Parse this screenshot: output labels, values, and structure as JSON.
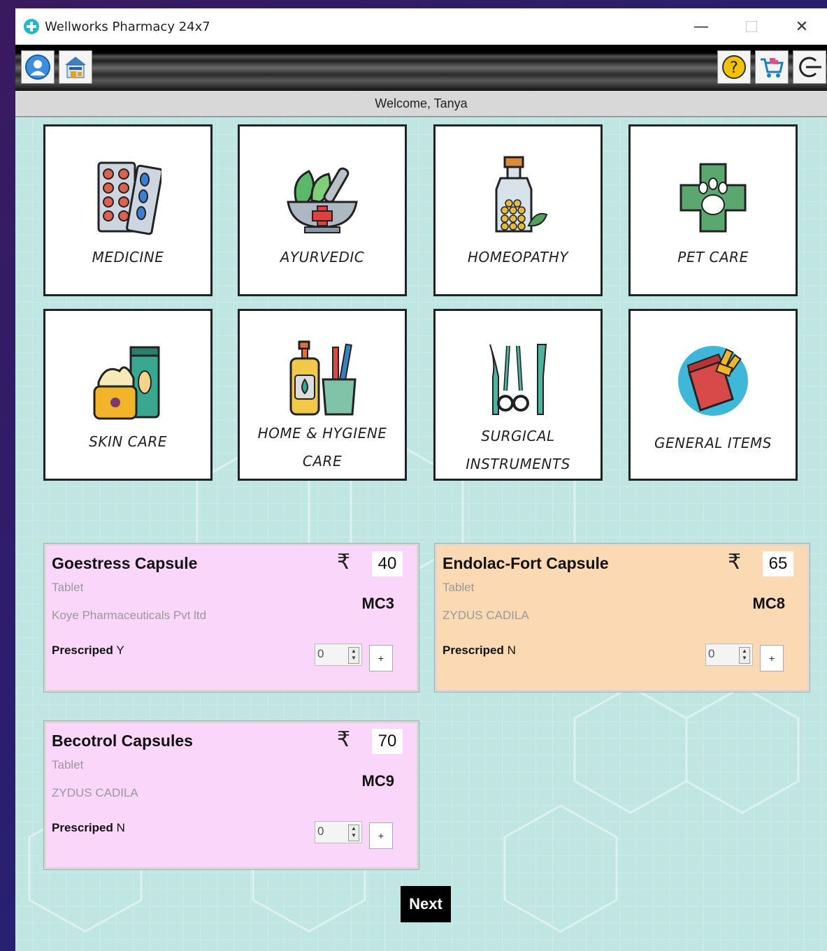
{
  "window": {
    "title": "Wellworks Pharmacy 24x7",
    "controls": {
      "minimize": "—",
      "close": "✕"
    }
  },
  "toolbar": {
    "left_icons": [
      "user-profile-icon",
      "store-icon"
    ],
    "right_icons": [
      "help-icon",
      "cart-icon",
      "logout-icon"
    ],
    "help_glyph": "?"
  },
  "welcome": {
    "text": "Welcome, Tanya"
  },
  "categories": [
    {
      "label": "MEDICINE",
      "icon": "medicine-blister-icon"
    },
    {
      "label": "AYURVEDIC",
      "icon": "mortar-pestle-icon"
    },
    {
      "label": "HOMEOPATHY",
      "icon": "homeopathy-bottle-icon"
    },
    {
      "label": "PET CARE",
      "icon": "pet-care-cross-icon"
    },
    {
      "label": "SKIN CARE",
      "icon": "skin-care-cream-icon"
    },
    {
      "label_line1": "HOME & HYGIENE",
      "label_line2": "CARE",
      "icon": "soap-toothbrush-icon"
    },
    {
      "label_line1": "SURGICAL",
      "label_line2": "INSTRUMENTS",
      "icon": "surgical-tools-icon"
    },
    {
      "label": "GENERAL ITEMS",
      "icon": "general-items-bag-icon"
    }
  ],
  "products": [
    {
      "name": "Goestress Capsule",
      "price": "40",
      "currency": "₹",
      "type": "Tablet",
      "maker": "Koye Pharmaceuticals Pvt ltd",
      "code": "MC3",
      "prescribed_label": "Prescriped",
      "prescribed": "Y",
      "qty": "0",
      "add_label": "+",
      "color": "#fad6fb"
    },
    {
      "name": "Endolac-Fort Capsule",
      "price": "65",
      "currency": "₹",
      "type": "Tablet",
      "maker": "ZYDUS CADILA",
      "code": "MC8",
      "prescribed_label": "Prescriped",
      "prescribed": "N",
      "qty": "0",
      "add_label": "+",
      "color": "#fbd9b2"
    },
    {
      "name": "Becotrol Capsules",
      "price": "70",
      "currency": "₹",
      "type": "Tablet",
      "maker": "ZYDUS CADILA",
      "code": "MC9",
      "prescribed_label": "Prescriped",
      "prescribed": "N",
      "qty": "0",
      "add_label": "+",
      "color": "#fad6fb"
    }
  ],
  "next_button": {
    "label": "Next"
  }
}
